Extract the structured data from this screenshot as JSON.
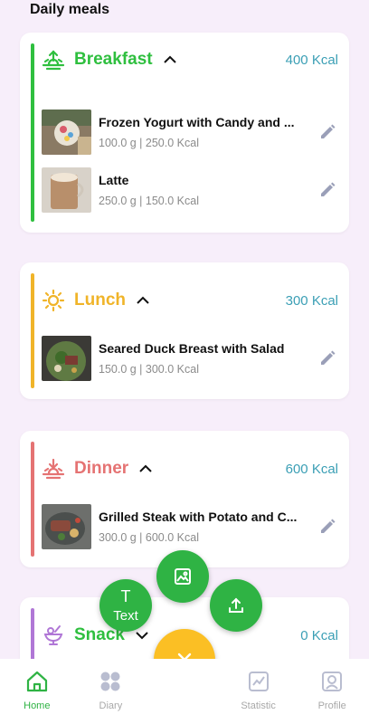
{
  "page": {
    "title": "Daily meals"
  },
  "meals": [
    {
      "name": "Breakfast",
      "kcal": "400 Kcal",
      "color": "#2fbf3f",
      "icon": "sunrise-icon",
      "foods": [
        {
          "name": "Frozen Yogurt with Candy and ...",
          "meta": "100.0 g | 250.0 Kcal",
          "image": "frozen-yogurt-photo"
        },
        {
          "name": "Latte",
          "meta": "250.0 g | 150.0 Kcal",
          "image": "latte-photo"
        }
      ]
    },
    {
      "name": "Lunch",
      "kcal": "300 Kcal",
      "color": "#f0b429",
      "icon": "sun-icon",
      "foods": [
        {
          "name": "Seared Duck Breast with Salad",
          "meta": "150.0 g | 300.0 Kcal",
          "image": "duck-salad-photo"
        }
      ]
    },
    {
      "name": "Dinner",
      "kcal": "600 Kcal",
      "color": "#e57373",
      "icon": "sunset-icon",
      "foods": [
        {
          "name": "Grilled Steak with Potato and C...",
          "meta": "300.0 g | 600.0 Kcal",
          "image": "steak-photo"
        }
      ]
    },
    {
      "name": "Snack",
      "kcal": "0 Kcal",
      "color": "#b077d6",
      "icon": "ice-cream-icon",
      "foods": []
    }
  ],
  "fab": {
    "text_icon": "T",
    "text_label": "Text",
    "image_icon": "image-icon",
    "upload_icon": "upload-icon",
    "close_icon": "close-icon",
    "green": "#2fb344",
    "yellow": "#fbbf24"
  },
  "nav": [
    {
      "label": "Home",
      "icon": "home-icon",
      "active": true
    },
    {
      "label": "Diary",
      "icon": "grid-icon",
      "active": false
    },
    {
      "label": "",
      "icon": "",
      "active": false
    },
    {
      "label": "Statistic",
      "icon": "chart-icon",
      "active": false
    },
    {
      "label": "Profile",
      "icon": "profile-icon",
      "active": false
    }
  ]
}
